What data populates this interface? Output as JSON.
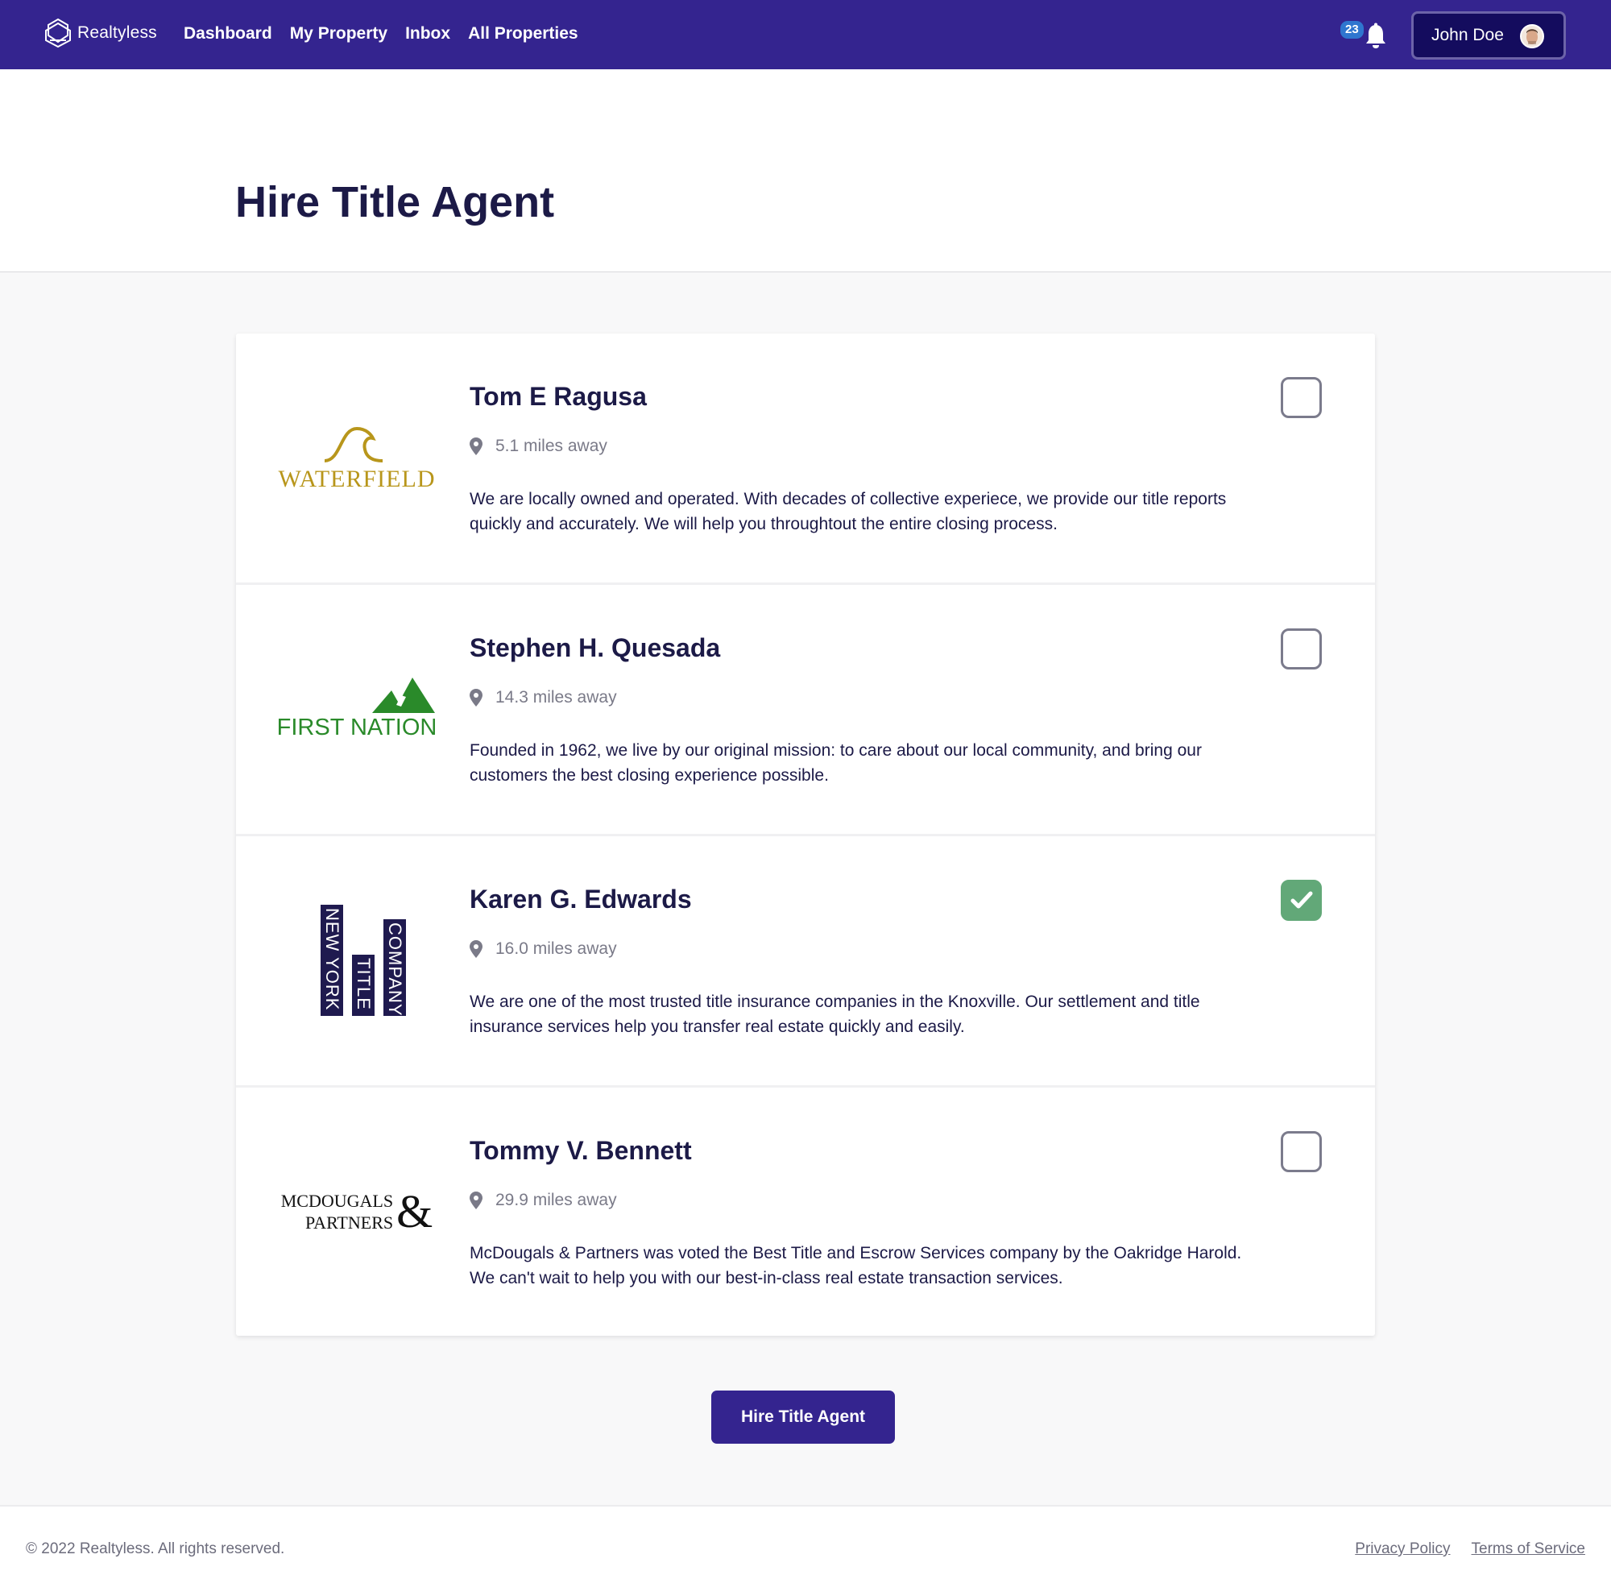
{
  "nav": {
    "brand": "Realtyless",
    "links": [
      "Dashboard",
      "My Property",
      "Inbox",
      "All Properties"
    ],
    "notification_count": "23",
    "user_name": "John Doe"
  },
  "page": {
    "title": "Hire Title Agent"
  },
  "agents": [
    {
      "name": "Tom E Ragusa",
      "company_logo": "WATERFIELD",
      "distance": "5.1 miles away",
      "description": "We are locally owned and operated. With decades of collective experiece, we provide our title reports quickly and accurately. We will help you throughtout the entire closing process.",
      "selected": false
    },
    {
      "name": "Stephen H. Quesada",
      "company_logo": "FIRST NATION",
      "distance": "14.3 miles away",
      "description": "Founded in 1962, we live by our original mission: to care about our local community, and bring our customers the best closing experience possible.",
      "selected": false
    },
    {
      "name": "Karen G. Edwards",
      "company_logo": {
        "line1": "NEW YORK",
        "line2": "TITLE",
        "line3": "COMPANY"
      },
      "distance": "16.0 miles away",
      "description": "We are one of the most trusted title insurance companies in the Knoxville. Our settlement and title insurance services help you transfer real estate quickly and easily.",
      "selected": true
    },
    {
      "name": "Tommy V. Bennett",
      "company_logo": {
        "line1": "MCDOUGALS",
        "line2": "PARTNERS",
        "amp": "&"
      },
      "distance": "29.9 miles away",
      "description": "McDougals & Partners was voted the Best Title and Escrow Services company by the Oakridge Harold. We can't wait to help you with our best-in-class real estate transaction services.",
      "selected": false
    }
  ],
  "actions": {
    "hire_button": "Hire Title Agent"
  },
  "footer": {
    "copyright": "© 2022 Realtyless. All rights reserved.",
    "links": [
      "Privacy Policy",
      "Terms of Service"
    ]
  },
  "colors": {
    "primary": "#34248f",
    "checked": "#62a878",
    "text_dark": "#1c1a47"
  }
}
